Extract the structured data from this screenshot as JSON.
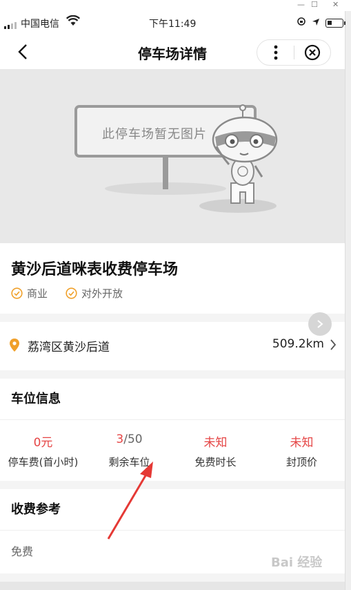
{
  "status_bar": {
    "carrier": "中国电信",
    "time": "下午11:49"
  },
  "nav": {
    "title": "停车场详情"
  },
  "banner": {
    "placeholder_text": "此停车场暂无图片"
  },
  "parking": {
    "name": "黄沙后道咪表收费停车场",
    "tags": [
      "商业",
      "对外开放"
    ],
    "address": "荔湾区黄沙后道",
    "distance": "509.2km"
  },
  "space_info": {
    "title": "车位信息",
    "stats": [
      {
        "value": "0元",
        "label": "停车费(首小时)"
      },
      {
        "value_left": "3",
        "value_total": "/50",
        "label": "剩余车位"
      },
      {
        "value": "未知",
        "label": "免费时长"
      },
      {
        "value": "未知",
        "label": "封顶价"
      }
    ]
  },
  "fee_ref": {
    "title": "收费参考",
    "text": "免费"
  },
  "colors": {
    "accent_red": "#e54545",
    "tag_orange": "#f0a02a"
  }
}
